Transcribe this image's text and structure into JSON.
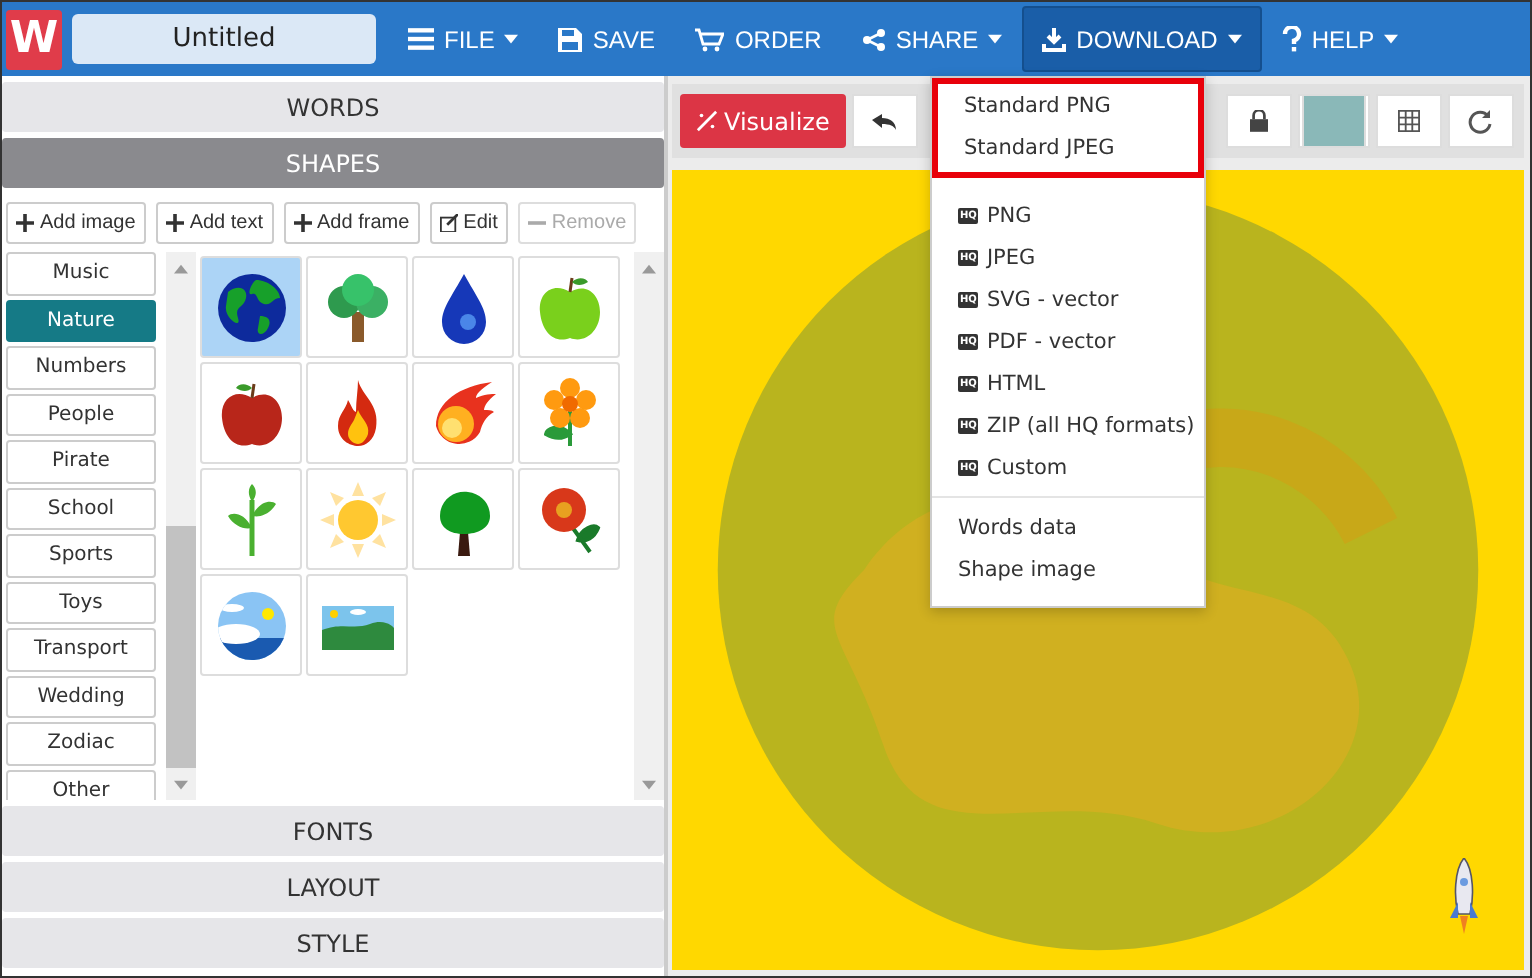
{
  "topbar": {
    "logo": "W",
    "title_field": {
      "value": "Untitled"
    },
    "menu": [
      {
        "label": "FILE",
        "dropdown": true,
        "selected": false
      },
      {
        "label": "SAVE",
        "dropdown": false,
        "selected": false
      },
      {
        "label": "ORDER",
        "dropdown": false,
        "selected": false
      },
      {
        "label": "SHARE",
        "dropdown": true,
        "selected": false
      },
      {
        "label": "DOWNLOAD",
        "dropdown": true,
        "selected": true
      },
      {
        "label": "HELP",
        "dropdown": true,
        "selected": false
      }
    ]
  },
  "sidebar": {
    "sections": [
      {
        "label": "WORDS",
        "expanded": false
      },
      {
        "label": "SHAPES",
        "expanded": true
      },
      {
        "label": "FONTS",
        "expanded": false
      },
      {
        "label": "LAYOUT",
        "expanded": false
      },
      {
        "label": "STYLE",
        "expanded": false
      }
    ],
    "shape_buttons": [
      {
        "label": "Add image",
        "disabled": false
      },
      {
        "label": "Add text",
        "disabled": false
      },
      {
        "label": "Add frame",
        "disabled": false
      },
      {
        "label": "Edit",
        "disabled": false
      },
      {
        "label": "Remove",
        "disabled": true
      }
    ],
    "categories": [
      {
        "label": "Music",
        "selected": false
      },
      {
        "label": "Nature",
        "selected": true
      },
      {
        "label": "Numbers",
        "selected": false
      },
      {
        "label": "People",
        "selected": false
      },
      {
        "label": "Pirate",
        "selected": false
      },
      {
        "label": "School",
        "selected": false
      },
      {
        "label": "Sports",
        "selected": false
      },
      {
        "label": "Toys",
        "selected": false
      },
      {
        "label": "Transport",
        "selected": false
      },
      {
        "label": "Wedding",
        "selected": false
      },
      {
        "label": "Zodiac",
        "selected": false
      },
      {
        "label": "Other",
        "selected": false
      }
    ],
    "shapes": [
      {
        "kind": "globe",
        "selected": true
      },
      {
        "kind": "tree",
        "selected": false
      },
      {
        "kind": "drop",
        "selected": false
      },
      {
        "kind": "green-apple",
        "selected": false
      },
      {
        "kind": "red-apple",
        "selected": false
      },
      {
        "kind": "flame",
        "selected": false
      },
      {
        "kind": "fireball",
        "selected": false
      },
      {
        "kind": "orange-flower",
        "selected": false
      },
      {
        "kind": "sprout",
        "selected": false
      },
      {
        "kind": "sun",
        "selected": false
      },
      {
        "kind": "dark-tree",
        "selected": false
      },
      {
        "kind": "red-flower",
        "selected": false
      },
      {
        "kind": "sky-circle",
        "selected": false
      },
      {
        "kind": "landscape",
        "selected": false
      }
    ]
  },
  "toolbar": {
    "visualize": "Visualize"
  },
  "download_menu": {
    "sections": [
      {
        "highlighted": true,
        "items": [
          {
            "label": "Standard PNG"
          },
          {
            "label": "Standard JPEG"
          }
        ]
      },
      {
        "highlighted": false,
        "items": [
          {
            "badge": "HQ",
            "label": "PNG"
          },
          {
            "badge": "HQ",
            "label": "JPEG"
          },
          {
            "badge": "HQ",
            "label": "SVG - vector"
          },
          {
            "badge": "HQ",
            "label": "PDF - vector"
          },
          {
            "badge": "HQ",
            "label": "HTML"
          },
          {
            "badge": "HQ",
            "label": "ZIP (all HQ formats)"
          },
          {
            "badge": "HQ",
            "label": "Custom"
          }
        ]
      },
      {
        "highlighted": false,
        "items": [
          {
            "label": "Words data"
          },
          {
            "label": "Shape image"
          }
        ]
      }
    ]
  }
}
